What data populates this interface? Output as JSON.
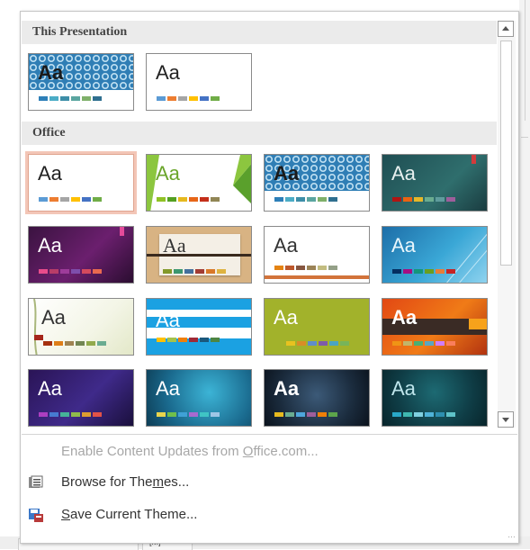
{
  "sections": [
    {
      "header": "This Presentation"
    },
    {
      "header": "Office"
    }
  ],
  "thumb_text": "Aa",
  "menu": {
    "enable_updates": {
      "before": "Enable Content Updates from ",
      "underlined": "O",
      "after": "ffice.com..."
    },
    "browse": {
      "before": "Browse for The",
      "underlined": "m",
      "after": "es...",
      "icon": "browse-themes-icon"
    },
    "save": {
      "before": "",
      "underlined": "S",
      "after": "ave Current Theme...",
      "icon": "save-theme-icon"
    }
  },
  "background": {
    "bottom_label": "[M]"
  },
  "colors": {
    "selection_outline": "#f3c6b7",
    "section_header_bg": "#ebebeb",
    "disabled_text": "#a7a7a7"
  }
}
